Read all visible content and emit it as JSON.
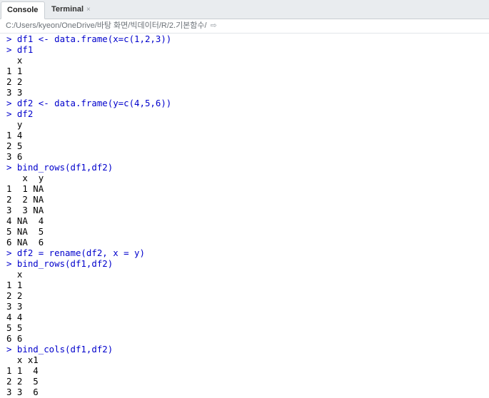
{
  "tabs": [
    {
      "label": "Console",
      "active": true
    },
    {
      "label": "Terminal",
      "active": false,
      "close": "×"
    }
  ],
  "path": {
    "text": "C:/Users/kyeon/OneDrive/바탕 화면/빅데이터/R/2.기본함수/",
    "arrow": "⇨"
  },
  "console_lines": [
    {
      "type": "cmd",
      "text": "> df1 <- data.frame(x=c(1,2,3))"
    },
    {
      "type": "cmd",
      "text": "> df1"
    },
    {
      "type": "out",
      "text": "  x"
    },
    {
      "type": "out",
      "text": "1 1"
    },
    {
      "type": "out",
      "text": "2 2"
    },
    {
      "type": "out",
      "text": "3 3"
    },
    {
      "type": "cmd",
      "text": "> df2 <- data.frame(y=c(4,5,6))"
    },
    {
      "type": "cmd",
      "text": "> df2"
    },
    {
      "type": "out",
      "text": "  y"
    },
    {
      "type": "out",
      "text": "1 4"
    },
    {
      "type": "out",
      "text": "2 5"
    },
    {
      "type": "out",
      "text": "3 6"
    },
    {
      "type": "cmd",
      "text": "> bind_rows(df1,df2)"
    },
    {
      "type": "out",
      "text": "   x  y"
    },
    {
      "type": "out",
      "text": "1  1 NA"
    },
    {
      "type": "out",
      "text": "2  2 NA"
    },
    {
      "type": "out",
      "text": "3  3 NA"
    },
    {
      "type": "out",
      "text": "4 NA  4"
    },
    {
      "type": "out",
      "text": "5 NA  5"
    },
    {
      "type": "out",
      "text": "6 NA  6"
    },
    {
      "type": "cmd",
      "text": "> df2 = rename(df2, x = y)"
    },
    {
      "type": "cmd",
      "text": "> bind_rows(df1,df2)"
    },
    {
      "type": "out",
      "text": "  x"
    },
    {
      "type": "out",
      "text": "1 1"
    },
    {
      "type": "out",
      "text": "2 2"
    },
    {
      "type": "out",
      "text": "3 3"
    },
    {
      "type": "out",
      "text": "4 4"
    },
    {
      "type": "out",
      "text": "5 5"
    },
    {
      "type": "out",
      "text": "6 6"
    },
    {
      "type": "cmd",
      "text": "> bind_cols(df1,df2)"
    },
    {
      "type": "out",
      "text": "  x x1"
    },
    {
      "type": "out",
      "text": "1 1  4"
    },
    {
      "type": "out",
      "text": "2 2  5"
    },
    {
      "type": "out",
      "text": "3 3  6"
    }
  ]
}
